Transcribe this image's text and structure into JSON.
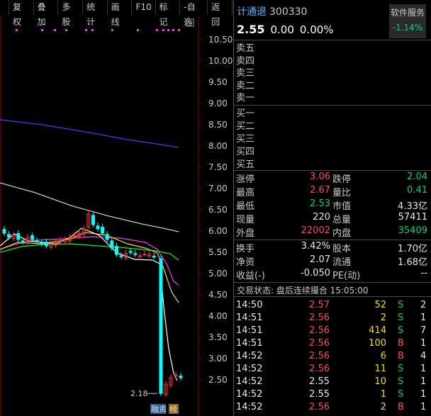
{
  "toolbar": {
    "items": [
      "复权",
      "叠加",
      "多股",
      "统计",
      "画线",
      "F10",
      "标记",
      "-自选",
      "返回"
    ]
  },
  "chart": {
    "y_ticks": [
      "10.50",
      "10.00",
      "9.50",
      "9.00",
      "8.50",
      "8.00",
      "7.50",
      "7.00",
      "6.50",
      "6.00",
      "5.50",
      "5.00",
      "4.50",
      "4.00",
      "3.50",
      "3.00",
      "2.50"
    ],
    "low_label": "2.18",
    "badges": [
      "融资",
      "榜"
    ],
    "colors": {
      "up": "#ff3333",
      "down": "#00ffff",
      "ma5": "#ffffff",
      "ma10": "#f0e000",
      "ma20": "#ff33ff",
      "ma30": "#00ff00",
      "ma60": "#c8c8c8",
      "ma250": "#3344ff"
    },
    "candle_closes": [
      5.95,
      5.85,
      5.9,
      5.8,
      5.75,
      5.85,
      5.8,
      5.75,
      5.7,
      5.65,
      5.7,
      5.72,
      5.78,
      5.8,
      5.85,
      5.9,
      5.95,
      6.05,
      6.4,
      6.15,
      6.05,
      5.95,
      5.8,
      5.6,
      5.45,
      5.4,
      5.48,
      5.5,
      5.45,
      5.42,
      5.46,
      5.44,
      5.4,
      2.18,
      2.4,
      2.55,
      2.62,
      2.55
    ]
  },
  "quote": {
    "name": "计通退",
    "code": "300330",
    "service_label": "软件服务",
    "service_pct": "-1.14%",
    "price": "2.55",
    "change": "0.00",
    "change_pct": "0.00%"
  },
  "order_book": {
    "sell": [
      "卖五",
      "卖四",
      "卖三",
      "卖二",
      "卖一"
    ],
    "buy": [
      "买一",
      "买二",
      "买三",
      "买四",
      "买五"
    ]
  },
  "stats": [
    {
      "l1": "涨停",
      "v1": "3.06",
      "c1": "red",
      "l2": "跌停",
      "v2": "2.04",
      "c2": "green"
    },
    {
      "l1": "最高",
      "v1": "2.67",
      "c1": "red",
      "l2": "量比",
      "v2": "0.41",
      "c2": "green"
    },
    {
      "l1": "最低",
      "v1": "2.53",
      "c1": "green",
      "l2": "市值",
      "v2": "4.33亿",
      "c2": "white"
    },
    {
      "l1": "现量",
      "v1": "220",
      "c1": "white",
      "l2": "总量",
      "v2": "57411",
      "c2": "white"
    },
    {
      "l1": "外盘",
      "v1": "22002",
      "c1": "red",
      "l2": "内盘",
      "v2": "35409",
      "c2": "green"
    }
  ],
  "stats2": [
    {
      "l1": "换手",
      "v1": "3.42%",
      "l2": "股本",
      "v2": "1.70亿"
    },
    {
      "l1": "净资",
      "v1": "2.07",
      "l2": "流通",
      "v2": "1.68亿"
    },
    {
      "l1": "收益(-)",
      "v1": "-0.050",
      "l2": "PE(动)",
      "v2": "--"
    }
  ],
  "status_line": "交易状态: 盘后连续撮合 15:05:00",
  "trades": [
    {
      "time": "14:50",
      "price": "2.57",
      "pc": "red",
      "vol": "52",
      "side": "S",
      "n": "2"
    },
    {
      "time": "14:51",
      "price": "2.56",
      "pc": "red",
      "vol": "2",
      "side": "S",
      "n": "1"
    },
    {
      "time": "14:51",
      "price": "2.56",
      "pc": "red",
      "vol": "414",
      "side": "S",
      "n": "7"
    },
    {
      "time": "14:51",
      "price": "2.56",
      "pc": "red",
      "vol": "100",
      "side": "B",
      "n": "1"
    },
    {
      "time": "14:52",
      "price": "2.56",
      "pc": "red",
      "vol": "6",
      "side": "B",
      "n": "4"
    },
    {
      "time": "14:52",
      "price": "2.56",
      "pc": "red",
      "vol": "11",
      "side": "S",
      "n": "1"
    },
    {
      "time": "14:52",
      "price": "2.55",
      "pc": "white",
      "vol": "10",
      "side": "S",
      "n": "1"
    },
    {
      "time": "14:52",
      "price": "2.55",
      "pc": "white",
      "vol": "1",
      "side": "S",
      "n": "1"
    },
    {
      "time": "14:52",
      "price": "2.56",
      "pc": "red",
      "vol": "2",
      "side": "B",
      "n": "1"
    }
  ]
}
